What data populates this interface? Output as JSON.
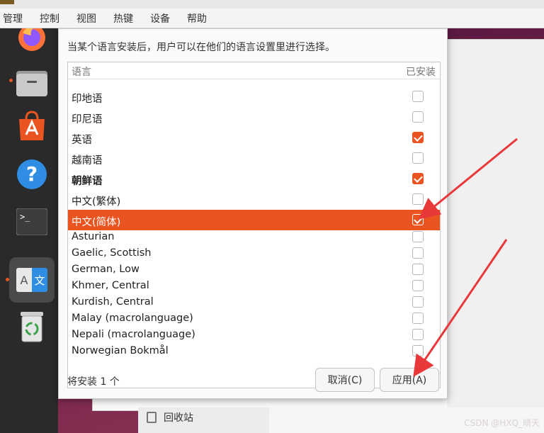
{
  "menubar": {
    "items": [
      "管理",
      "控制",
      "视图",
      "热键",
      "设备",
      "帮助"
    ]
  },
  "dock": {
    "items": [
      {
        "name": "firefox-icon"
      },
      {
        "name": "files-icon"
      },
      {
        "name": "app-center-icon"
      },
      {
        "name": "help-icon"
      },
      {
        "name": "terminal-icon"
      },
      {
        "name": "language-support-icon",
        "glyph_a": "A",
        "glyph_b": "文"
      },
      {
        "name": "trash-icon"
      }
    ]
  },
  "background": {
    "trash_label": "回收站"
  },
  "dialog": {
    "intro": "当某个语言安装后，用户可以在他们的语言设置里进行选择。",
    "columns": {
      "language": "语言",
      "installed": "已安装"
    },
    "languages": [
      {
        "name": "印地语",
        "installed": false,
        "selected": false,
        "bold": false
      },
      {
        "name": "印尼语",
        "installed": false,
        "selected": false,
        "bold": false
      },
      {
        "name": "英语",
        "installed": true,
        "selected": false,
        "bold": false
      },
      {
        "name": "越南语",
        "installed": false,
        "selected": false,
        "bold": false
      },
      {
        "name": "朝鲜语",
        "installed": true,
        "selected": false,
        "bold": true
      },
      {
        "name": "中文(繁体)",
        "installed": false,
        "selected": false,
        "bold": false
      },
      {
        "name": "中文(简体)",
        "installed": true,
        "selected": true,
        "bold": false
      },
      {
        "name": "Asturian",
        "installed": false,
        "selected": false,
        "bold": false
      },
      {
        "name": "Gaelic, Scottish",
        "installed": false,
        "selected": false,
        "bold": false
      },
      {
        "name": "German, Low",
        "installed": false,
        "selected": false,
        "bold": false
      },
      {
        "name": "Khmer, Central",
        "installed": false,
        "selected": false,
        "bold": false
      },
      {
        "name": "Kurdish, Central",
        "installed": false,
        "selected": false,
        "bold": false
      },
      {
        "name": "Malay (macrolanguage)",
        "installed": false,
        "selected": false,
        "bold": false
      },
      {
        "name": "Nepali (macrolanguage)",
        "installed": false,
        "selected": false,
        "bold": false
      },
      {
        "name": "Norwegian Bokmål",
        "installed": false,
        "selected": false,
        "bold": false
      }
    ],
    "status": "将安装 1 个",
    "cancel_label": "取消(C)",
    "apply_label": "应用(A)"
  },
  "watermark": "CSDN @HXQ_晴天",
  "colors": {
    "accent": "#e95420",
    "annotation_arrow": "#e8383a"
  }
}
